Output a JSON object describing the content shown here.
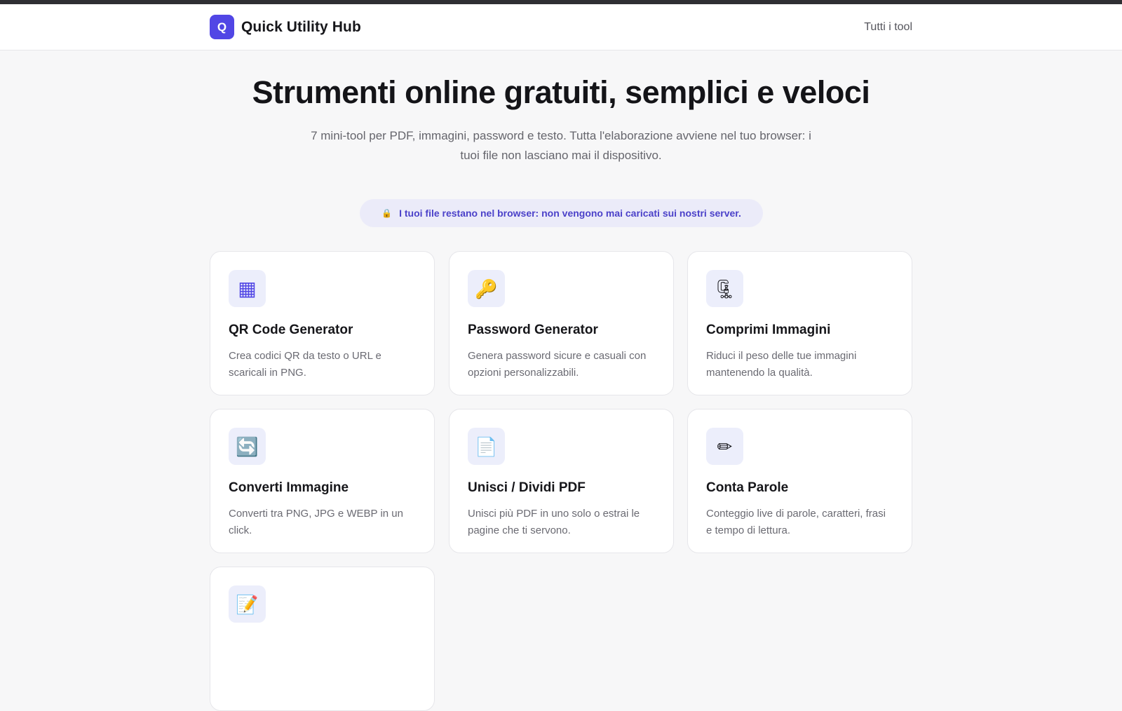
{
  "header": {
    "logo_letter": "Q",
    "brand": "Quick Utility Hub",
    "nav_all_tools": "Tutti i tool"
  },
  "hero": {
    "title": "Strumenti online gratuiti, semplici e veloci",
    "subtitle": "7 mini-tool per PDF, immagini, password e testo. Tutta l'elaborazione avviene nel tuo browser: i tuoi file non lasciano mai il dispositivo."
  },
  "privacy_notice": {
    "icon": "lock-icon",
    "text": "I tuoi file restano nel browser: non vengono mai caricati sui nostri server."
  },
  "tools": [
    {
      "icon": "qr-grid-icon",
      "glyph": "▦",
      "title": "QR Code Generator",
      "description": "Crea codici QR da testo o URL e scaricali in PNG."
    },
    {
      "icon": "key-icon",
      "glyph": "🔑",
      "title": "Password Generator",
      "description": "Genera password sicure e casuali con opzioni personalizzabili."
    },
    {
      "icon": "clamp-icon",
      "glyph": "🗜",
      "title": "Comprimi Immagini",
      "description": "Riduci il peso delle tue immagini mantenendo la qualità."
    },
    {
      "icon": "convert-arrows-icon",
      "glyph": "🔄",
      "title": "Converti Immagine",
      "description": "Converti tra PNG, JPG e WEBP in un click."
    },
    {
      "icon": "document-icon",
      "glyph": "📄",
      "title": "Unisci / Dividi PDF",
      "description": "Unisci più PDF in uno solo o estrai le pagine che ti servono."
    },
    {
      "icon": "pencil-icon",
      "glyph": "✏",
      "title": "Conta Parole",
      "description": "Conteggio live di parole, caratteri, frasi e tempo di lettura."
    },
    {
      "icon": "memo-icon",
      "glyph": "📝",
      "title": "",
      "description": ""
    }
  ],
  "colors": {
    "accent": "#5146e5",
    "background": "#f7f7f8",
    "pill_background": "#ebebf9",
    "pill_text": "#4b41c9"
  }
}
